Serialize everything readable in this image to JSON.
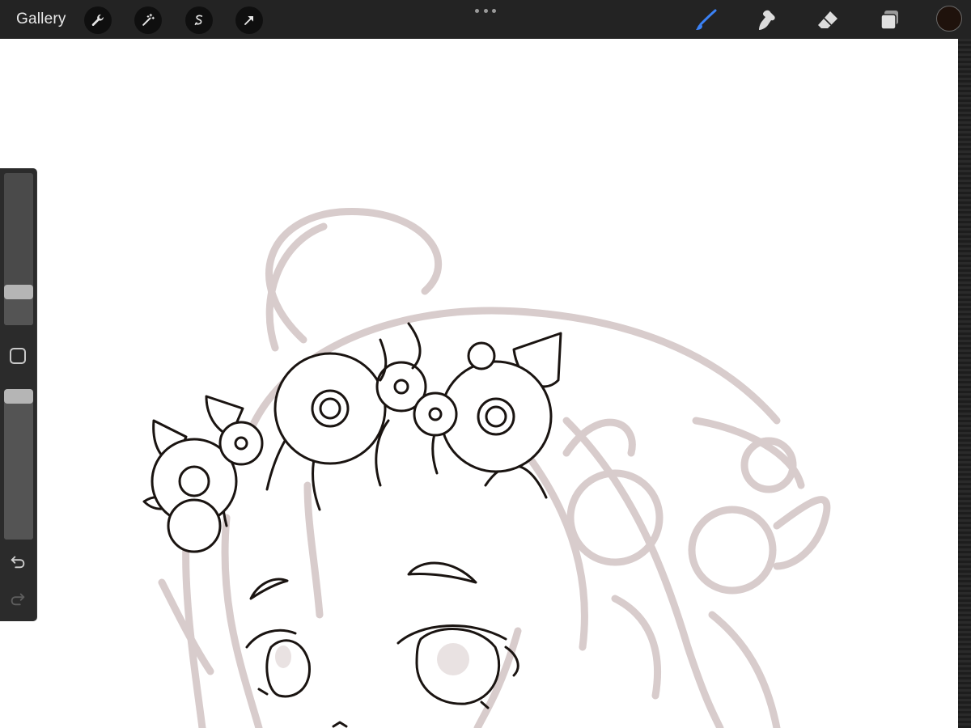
{
  "app": {
    "gallery_label": "Gallery"
  },
  "toolbar": {
    "left_tools": [
      {
        "name": "actions",
        "icon": "wrench-icon"
      },
      {
        "name": "adjustments",
        "icon": "magic-wand-icon"
      },
      {
        "name": "selection",
        "icon": "selection-s-icon"
      },
      {
        "name": "transform",
        "icon": "transform-arrow-icon"
      }
    ],
    "right_tools": [
      {
        "name": "brush",
        "icon": "brush-icon",
        "active": true
      },
      {
        "name": "smudge",
        "icon": "smudge-icon",
        "active": false
      },
      {
        "name": "eraser",
        "icon": "eraser-icon",
        "active": false
      },
      {
        "name": "layers",
        "icon": "layers-icon",
        "active": false
      }
    ],
    "more_menu_icon": "more-dots-icon"
  },
  "colors": {
    "active_tool": "#3b82f6",
    "current_color": "#1f120c",
    "sketch_lines": "#d8cccc",
    "ink_lines": "#1a1411",
    "canvas": "#ffffff"
  },
  "sidebar": {
    "brush_size_level": 0.22,
    "opacity_level": 0.97,
    "modify_button_icon": "square-modify-icon",
    "undo_icon": "undo-icon",
    "redo_icon": "redo-icon"
  }
}
